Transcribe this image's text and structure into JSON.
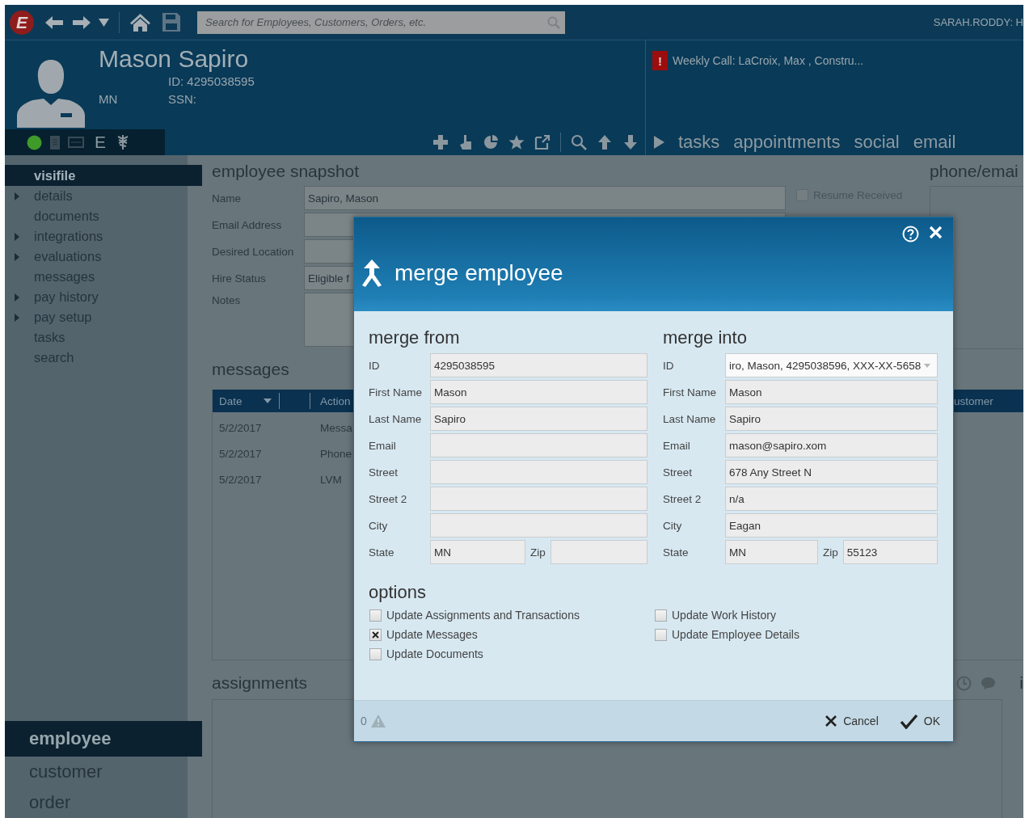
{
  "topbar": {
    "logo": "E",
    "search": {
      "placeholder": "Search for Employees, Customers, Orders, etc."
    },
    "user": "SARAH.RODDY: H"
  },
  "header": {
    "name": "Mason Sapiro",
    "id": "ID: 4295038595",
    "state": "MN",
    "ssn": "SSN:",
    "alert": {
      "mark": "!",
      "text": "Weekly Call: LaCroix, Max , Constru..."
    }
  },
  "status_bar": {
    "online": true,
    "flag": "E"
  },
  "tabs": [
    {
      "label": "tasks",
      "selected": false
    },
    {
      "label": "appointments",
      "selected": false
    },
    {
      "label": "social",
      "selected": false
    },
    {
      "label": "email",
      "selected": false
    }
  ],
  "sidebar": {
    "items": [
      {
        "label": "visifile",
        "selected": true,
        "expandable": false
      },
      {
        "label": "details",
        "selected": false,
        "expandable": true
      },
      {
        "label": "documents",
        "selected": false,
        "expandable": false
      },
      {
        "label": "integrations",
        "selected": false,
        "expandable": true
      },
      {
        "label": "evaluations",
        "selected": false,
        "expandable": true
      },
      {
        "label": "messages",
        "selected": false,
        "expandable": false
      },
      {
        "label": "pay history",
        "selected": false,
        "expandable": true
      },
      {
        "label": "pay setup",
        "selected": false,
        "expandable": true
      },
      {
        "label": "tasks",
        "selected": false,
        "expandable": false
      },
      {
        "label": "search",
        "selected": false,
        "expandable": false
      }
    ],
    "modules": [
      {
        "label": "employee",
        "selected": true
      },
      {
        "label": "customer",
        "selected": false
      },
      {
        "label": "order",
        "selected": false
      }
    ]
  },
  "snapshot": {
    "title": "employee snapshot",
    "fields": [
      {
        "label": "Name",
        "value": "Sapiro, Mason",
        "kind": "text"
      },
      {
        "label": "Email Address",
        "kind": "text"
      },
      {
        "label": "Desired Location",
        "kind": "text"
      },
      {
        "label": "Hire Status",
        "value": "Eligible f",
        "kind": "text"
      },
      {
        "label": "Notes",
        "kind": "textarea"
      }
    ],
    "checkboxes": [
      {
        "label": "Resume Received",
        "checked": false
      }
    ]
  },
  "phone_email": {
    "title": "phone/emai"
  },
  "messages": {
    "title": "messages",
    "columns": [
      {
        "label": "Date",
        "sorted": true
      },
      {
        "label": "Action"
      },
      {
        "label": "ustomer"
      }
    ],
    "rows": [
      {
        "date": "5/2/2017",
        "action": "Messa"
      },
      {
        "date": "5/2/2017",
        "action": "Phone"
      },
      {
        "date": "5/2/2017",
        "action": "LVM"
      }
    ]
  },
  "assignments": {
    "title": "assignments"
  },
  "side_panel": {
    "title": "i"
  },
  "dialog": {
    "title": "merge employee",
    "from": {
      "title": "merge from",
      "fields": [
        {
          "label": "ID",
          "value": "4295038595",
          "kind": "text"
        },
        {
          "label": "First Name",
          "value": "Mason",
          "kind": "text"
        },
        {
          "label": "Last Name",
          "value": "Sapiro",
          "kind": "text"
        },
        {
          "label": "Email",
          "kind": "text"
        },
        {
          "label": "Street",
          "kind": "text"
        },
        {
          "label": "Street 2",
          "kind": "text"
        },
        {
          "label": "City",
          "kind": "text"
        },
        {
          "label": "State",
          "value": "MN",
          "kind": "half"
        },
        {
          "label": "Zip",
          "kind": "half"
        }
      ]
    },
    "into": {
      "title": "merge into",
      "fields": [
        {
          "label": "ID",
          "value": "iro, Mason, 4295038596, XXX-XX-5658",
          "kind": "dropdown"
        },
        {
          "label": "First Name",
          "value": "Mason",
          "kind": "text"
        },
        {
          "label": "Last Name",
          "value": "Sapiro",
          "kind": "text"
        },
        {
          "label": "Email",
          "value": "mason@sapiro.xom",
          "kind": "text"
        },
        {
          "label": "Street",
          "value": "678 Any Street N",
          "kind": "text"
        },
        {
          "label": "Street 2",
          "value": "n/a",
          "kind": "text"
        },
        {
          "label": "City",
          "value": "Eagan",
          "kind": "text"
        },
        {
          "label": "State",
          "value": "MN",
          "kind": "half"
        },
        {
          "label": "Zip",
          "value": "55123",
          "kind": "half"
        }
      ]
    },
    "options": {
      "title": "options",
      "columns": [
        {
          "items": [
            {
              "label": "Update Assignments and Transactions",
              "checked": false
            },
            {
              "label": "Update Messages",
              "checked": true
            },
            {
              "label": "Update Documents",
              "checked": false
            }
          ]
        },
        {
          "items": [
            {
              "label": "Update Work History",
              "checked": false
            },
            {
              "label": "Update Employee Details",
              "checked": false
            }
          ]
        }
      ]
    },
    "warning_count": "0",
    "buttons": [
      {
        "label": "Cancel",
        "kind": "cancel"
      },
      {
        "label": "OK",
        "kind": "ok"
      }
    ]
  }
}
